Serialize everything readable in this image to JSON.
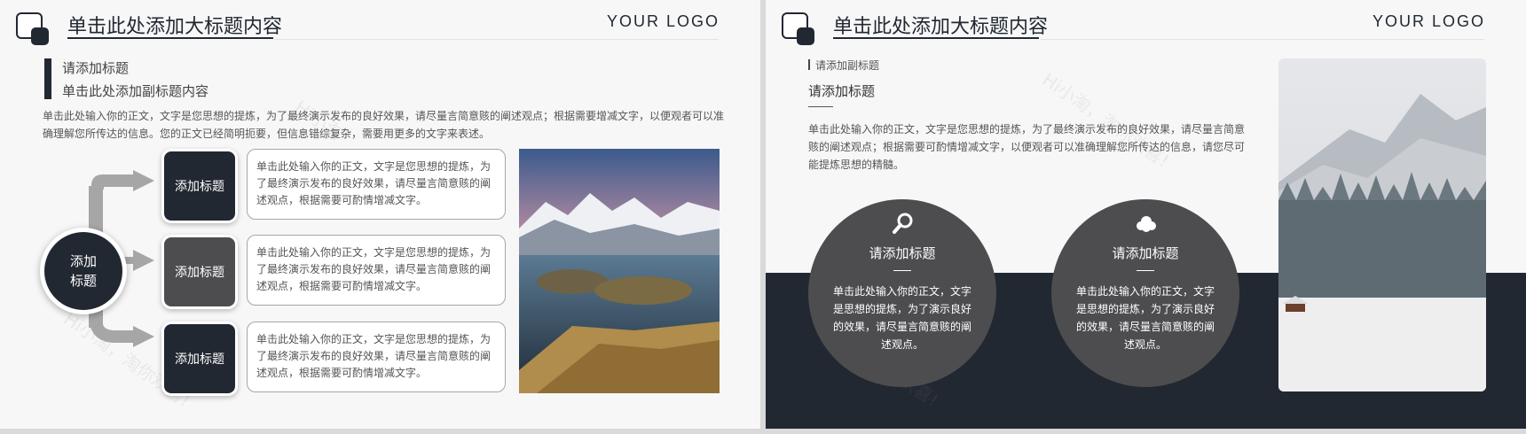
{
  "slide1": {
    "title": "单击此处添加大标题内容",
    "logo": "YOUR LOGO",
    "heading1": "请添加标题",
    "heading2": "单击此处添加副标题内容",
    "intro": "单击此处输入你的正文，文字是您思想的提炼，为了最终演示发布的良好效果，请尽量言简意赅的阐述观点；根据需要增减文字，以便观者可以准确理解您所传达的信息。您的正文已经简明扼要，但信息错综复杂，需要用更多的文字来表述。",
    "center_label": "添加\n标题",
    "items": [
      {
        "label": "添加标题",
        "text": "单击此处输入你的正文，文字是您思想的提炼，为了最终演示发布的良好效果，请尽量言简意赅的阐述观点，根据需要可酌情增减文字。"
      },
      {
        "label": "添加标题",
        "text": "单击此处输入你的正文，文字是您思想的提炼，为了最终演示发布的良好效果，请尽量言简意赅的阐述观点，根据需要可酌情增减文字。"
      },
      {
        "label": "添加标题",
        "text": "单击此处输入你的正文，文字是您思想的提炼，为了最终演示发布的良好效果，请尽量言简意赅的阐述观点，根据需要可酌情增减文字。"
      }
    ]
  },
  "slide2": {
    "title": "单击此处添加大标题内容",
    "logo": "YOUR LOGO",
    "subtitle_small": "请添加副标题",
    "heading": "请添加标题",
    "body": "单击此处输入你的正文，文字是您思想的提炼，为了最终演示发布的良好效果，请尽量言简意赅的阐述观点；根据需要可酌情增减文字，以便观者可以准确理解您所传达的信息，请您尽可能提炼思想的精髓。",
    "circles": [
      {
        "icon": "magnifier-icon",
        "title": "请添加标题",
        "text": "单击此处输入你的正文，文字是思想的提炼，为了演示良好的效果，请尽量言简意赅的阐述观点。"
      },
      {
        "icon": "cloud-icon",
        "title": "请添加标题",
        "text": "单击此处输入你的正文，文字是思想的提炼，为了演示良好的效果，请尽量言简意赅的阐述观点。"
      }
    ]
  },
  "colors": {
    "dark": "#222831",
    "mid": "#4d4d4f",
    "gray": "#a6a6a6",
    "bg": "#f7f7f8"
  }
}
